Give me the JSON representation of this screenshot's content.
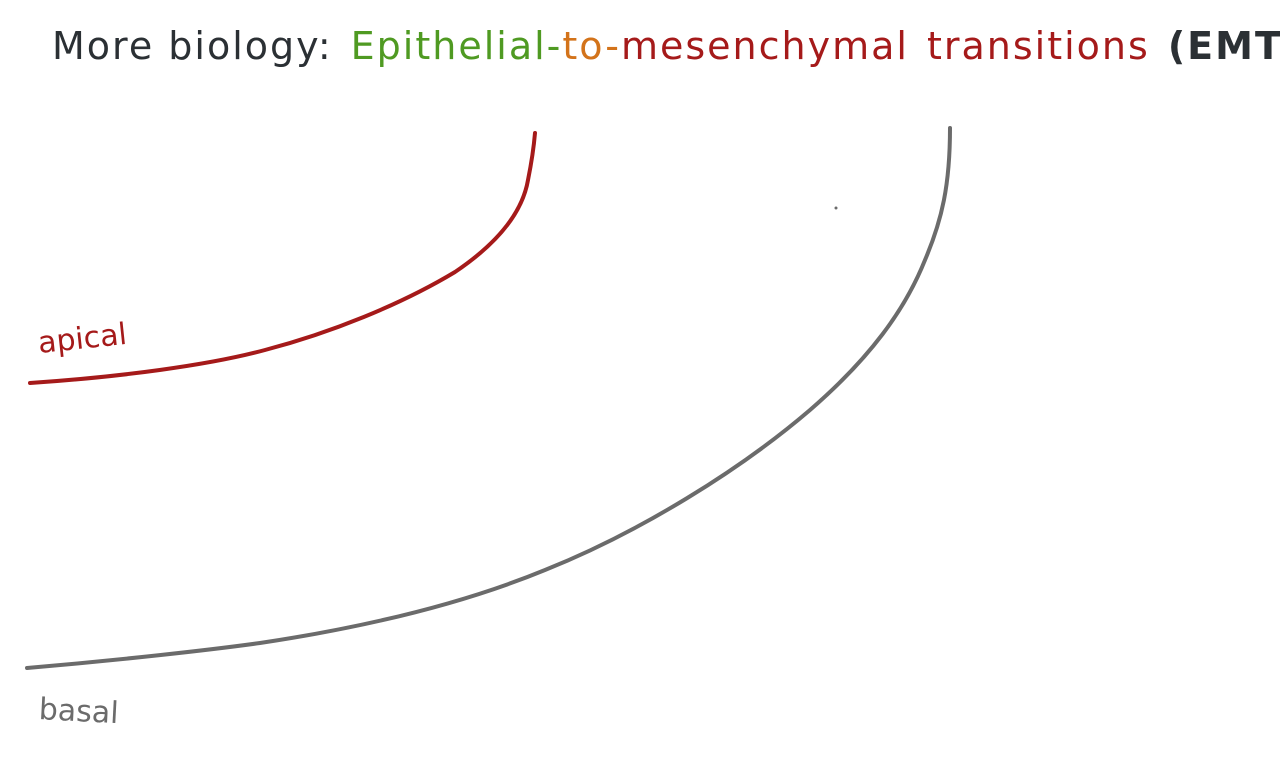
{
  "title": {
    "prefix": "More biology:",
    "epithelial": "Epithelial-",
    "to": "to-",
    "mesenchymal": "mesenchymal",
    "transitions": "transitions",
    "abbreviation": "(EMT)"
  },
  "labels": {
    "apical": "apical",
    "basal": "basal"
  },
  "colors": {
    "background": "#ffffff",
    "dark_text": "#2b3034",
    "epithelial_green": "#4f9a22",
    "to_orange": "#d3731a",
    "mesenchymal_red": "#a51a1a",
    "apical_curve": "#a51a1a",
    "basal_curve": "#6b6b6b"
  }
}
